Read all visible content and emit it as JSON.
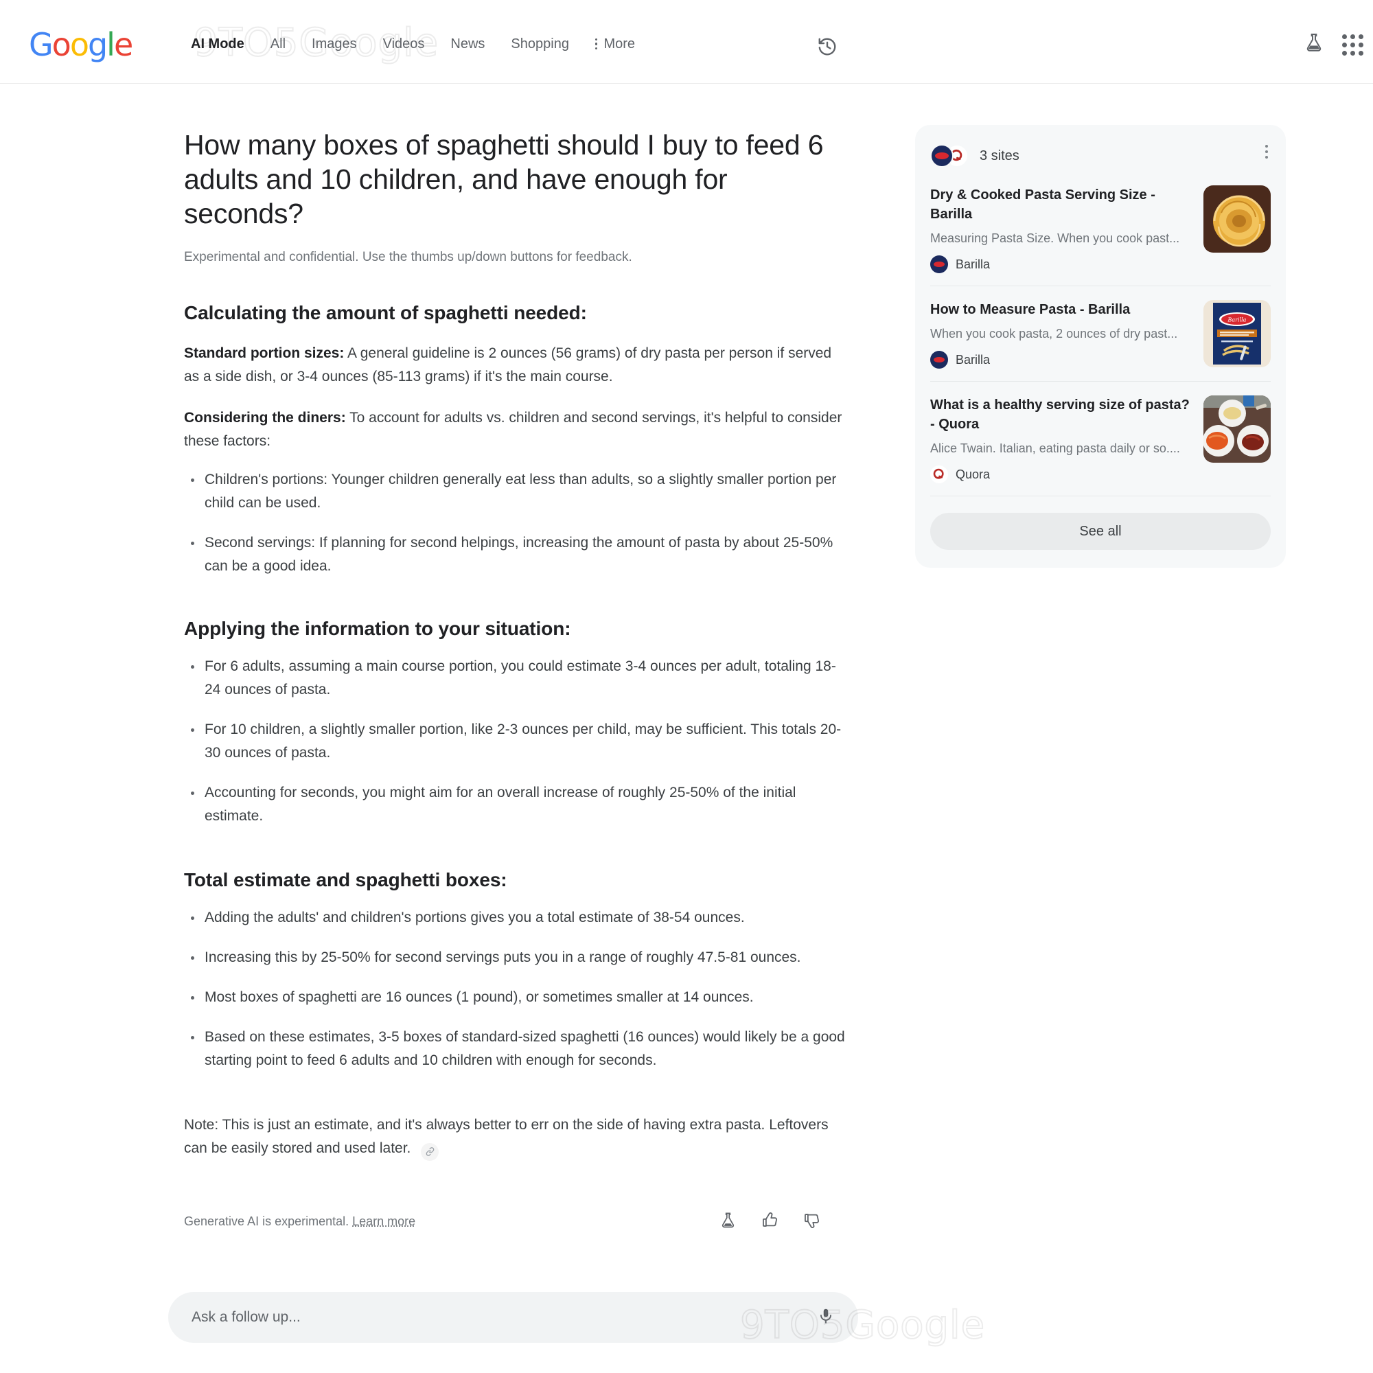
{
  "header": {
    "logo_letters": [
      {
        "ch": "G",
        "color": "#4285F4"
      },
      {
        "ch": "o",
        "color": "#EA4335"
      },
      {
        "ch": "o",
        "color": "#FBBC05"
      },
      {
        "ch": "g",
        "color": "#4285F4"
      },
      {
        "ch": "l",
        "color": "#34A853"
      },
      {
        "ch": "e",
        "color": "#EA4335"
      }
    ],
    "tabs": [
      {
        "label": "AI Mode",
        "active": true
      },
      {
        "label": "All",
        "active": false
      },
      {
        "label": "Images",
        "active": false
      },
      {
        "label": "Videos",
        "active": false
      },
      {
        "label": "News",
        "active": false
      },
      {
        "label": "Shopping",
        "active": false
      },
      {
        "label": "More",
        "active": false
      }
    ],
    "icons": {
      "history": "history-icon",
      "labs": "flask-icon",
      "apps": "google-apps-grid-icon"
    }
  },
  "watermark": {
    "text": "9TO5Google"
  },
  "answer": {
    "query": "How many boxes of spaghetti should I buy to feed 6 adults and 10 children, and have enough for seconds?",
    "disclaimer": "Experimental and confidential. Use the thumbs up/down buttons for feedback.",
    "sections": [
      {
        "heading": "Calculating the amount of spaghetti needed:",
        "paragraphs": [
          {
            "lead": "Standard portion sizes:",
            "text": " A general guideline is 2 ounces (56 grams) of dry pasta per person if served as a side dish, or 3-4 ounces (85-113 grams) if it's the main course."
          },
          {
            "lead": "Considering the diners:",
            "text": " To account for adults vs. children and second servings, it's helpful to consider these factors:"
          }
        ],
        "bullets": [
          "Children's portions: Younger children generally eat less than adults, so a slightly smaller portion per child can be used.",
          "Second servings: If planning for second helpings, increasing the amount of pasta by about 25-50% can be a good idea."
        ]
      },
      {
        "heading": "Applying the information to your situation:",
        "paragraphs": [],
        "bullets": [
          "For 6 adults, assuming a main course portion, you could estimate 3-4 ounces per adult, totaling 18-24 ounces of pasta.",
          "For 10 children, a slightly smaller portion, like 2-3 ounces per child, may be sufficient. This totals 20-30 ounces of pasta.",
          "Accounting for seconds, you might aim for an overall increase of roughly 25-50% of the initial estimate."
        ]
      },
      {
        "heading": "Total estimate and spaghetti boxes:",
        "paragraphs": [],
        "bullets": [
          "Adding the adults' and children's portions gives you a total estimate of 38-54 ounces.",
          "Increasing this by 25-50% for second servings puts you in a range of roughly 47.5-81 ounces.",
          "Most boxes of spaghetti are 16 ounces (1 pound), or sometimes smaller at 14 ounces.",
          "Based on these estimates, 3-5 boxes of standard-sized spaghetti (16 ounces) would likely be a good starting point to feed 6 adults and 10 children with enough for seconds."
        ]
      }
    ],
    "note": "Note: This is just an estimate, and it's always better to err on the side of having extra pasta. Leftovers can be easily stored and used later.",
    "citation_icon": "link-icon",
    "footer": {
      "text": "Generative AI is experimental.",
      "link_label": "Learn more",
      "icons": [
        "flask-icon",
        "thumbs-up-icon",
        "thumbs-down-icon"
      ]
    }
  },
  "sources": {
    "count_label": "3 sites",
    "menu_icon": "kebab-menu-icon",
    "items": [
      {
        "title": "Dry & Cooked Pasta Serving Size - Barilla",
        "snippet": "Measuring Pasta Size. When you cook past...",
        "source": "Barilla",
        "favicon": "barilla-favicon",
        "thumbnail": "spaghetti-nest-thumbnail"
      },
      {
        "title": "How to Measure Pasta - Barilla",
        "snippet": "When you cook pasta, 2 ounces of dry past...",
        "source": "Barilla",
        "favicon": "barilla-favicon",
        "thumbnail": "barilla-pasta-box-thumbnail"
      },
      {
        "title": "What is a healthy serving size of pasta? - Quora",
        "snippet": "Alice Twain. Italian, eating pasta daily or so....",
        "source": "Quora",
        "favicon": "quora-favicon",
        "thumbnail": "pasta-plates-thumbnail"
      }
    ],
    "see_all_label": "See all"
  },
  "followup": {
    "placeholder": "Ask a follow up...",
    "mic_icon": "microphone-icon"
  },
  "colors": {
    "google_blue": "#4285F4",
    "google_red": "#EA4335",
    "google_yellow": "#FBBC05",
    "google_green": "#34A853",
    "card_bg": "#f6f8f9",
    "input_bg": "#f1f3f4",
    "text_primary": "#202124",
    "text_secondary": "#5f6368"
  }
}
